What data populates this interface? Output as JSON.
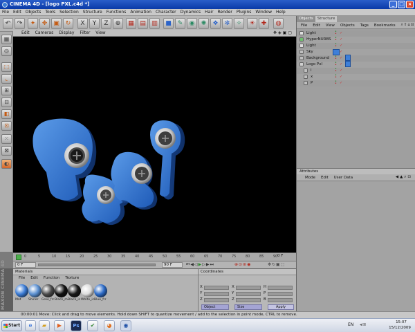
{
  "window": {
    "title": "CINEMA 4D - [logo PXL.c4d *]"
  },
  "menubar": {
    "items": [
      "File",
      "Edit",
      "Objects",
      "Tools",
      "Selection",
      "Structure",
      "Functions",
      "Animation",
      "Character",
      "Dynamics",
      "Hair",
      "Render",
      "Plugins",
      "Window",
      "Help"
    ]
  },
  "viewport": {
    "menu": [
      "Edit",
      "Cameras",
      "Display",
      "Filter",
      "View"
    ]
  },
  "timeline": {
    "ticks": [
      "0",
      "5",
      "10",
      "15",
      "20",
      "25",
      "30",
      "35",
      "40",
      "45",
      "50",
      "55",
      "60",
      "65",
      "70",
      "75",
      "80",
      "85",
      "90"
    ],
    "end_label": "0 F"
  },
  "transport": {
    "start": "0 F",
    "end": "90 F"
  },
  "materials": {
    "header": "Materials",
    "menu": [
      "File",
      "Edit",
      "Function",
      "Texture"
    ],
    "items": [
      {
        "label": "Mat",
        "color": "#3a7bd5"
      },
      {
        "label": "Shiner",
        "color": "#5a8fd0"
      },
      {
        "label": "Gree_frr",
        "color": "#4a4a4a"
      },
      {
        "label": "Black_m",
        "color": "#111111"
      },
      {
        "label": "Black_ic",
        "color": "#1a1a1a"
      },
      {
        "label": "White_ic",
        "color": "#dcdcdc"
      },
      {
        "label": "Blue_frr",
        "color": "#2d6bc7"
      }
    ]
  },
  "coordinates": {
    "header": "Coordinates",
    "rows": [
      [
        "X",
        "X",
        "H"
      ],
      [
        "Y",
        "Y",
        "P"
      ],
      [
        "Z",
        "Z",
        "B"
      ]
    ],
    "object_select": "Object",
    "size_select": "Size",
    "apply_label": "Apply"
  },
  "objects_panel": {
    "tabs": [
      "Objects",
      "Structure"
    ],
    "menu": [
      "File",
      "Edit",
      "View",
      "Objects",
      "Tags",
      "Bookmarks"
    ],
    "items": [
      {
        "name": "Light",
        "indent": 0,
        "color": "#e0e0e0"
      },
      {
        "name": "HyperNURBS",
        "indent": 0,
        "color": "#6fbf6f"
      },
      {
        "name": "Light",
        "indent": 0,
        "color": "#e0e0e0"
      },
      {
        "name": "Sky",
        "indent": 0,
        "color": "#c0c0c0"
      },
      {
        "name": "Background",
        "indent": 0,
        "color": "#c0c0c0"
      },
      {
        "name": "Logo Pxl",
        "indent": 0,
        "color": "#d0d0d0"
      },
      {
        "name": "l",
        "indent": 1,
        "color": "#c0c0c0"
      },
      {
        "name": "x",
        "indent": 1,
        "color": "#c0c0c0"
      },
      {
        "name": "P",
        "indent": 1,
        "color": "#c0c0c0"
      }
    ]
  },
  "attributes_panel": {
    "header": "Attributes",
    "menu": [
      "Mode",
      "Edit",
      "User Data"
    ]
  },
  "statusbar": {
    "text": "00:00:01  Move: Click and drag to move elements. Hold down SHIFT to quantize movement / add to the selection in point mode, CTRL to remove."
  },
  "taskbar": {
    "start_label": "Start",
    "language": "EN",
    "time": "15:07",
    "date": "15/12/2009"
  },
  "maxon_logo": "MAXON CINEMA 4D"
}
